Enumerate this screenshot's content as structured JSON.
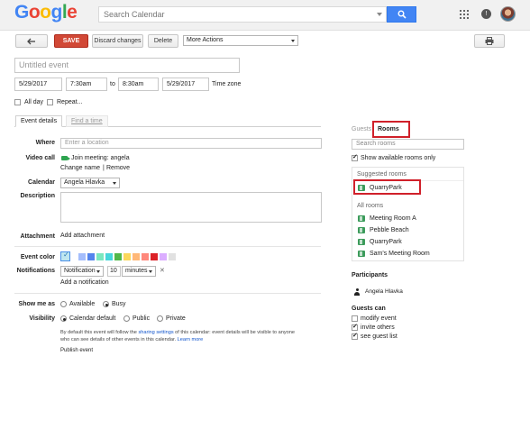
{
  "header": {
    "logo_letters": [
      {
        "ch": "G",
        "color": "#4285f4"
      },
      {
        "ch": "o",
        "color": "#ea4335"
      },
      {
        "ch": "o",
        "color": "#fbbc05"
      },
      {
        "ch": "g",
        "color": "#4285f4"
      },
      {
        "ch": "l",
        "color": "#34a853"
      },
      {
        "ch": "e",
        "color": "#ea4335"
      }
    ],
    "search_placeholder": "Search Calendar"
  },
  "toolbar": {
    "back_icon": "arrow-left-icon",
    "save": "SAVE",
    "discard": "Discard changes",
    "delete": "Delete",
    "more_actions": "More Actions",
    "print_icon": "printer-icon"
  },
  "event": {
    "title_placeholder": "Untitled event",
    "start_date": "5/29/2017",
    "start_time": "7:30am",
    "to": "to",
    "end_time": "8:30am",
    "end_date": "5/29/2017",
    "time_zone": "Time zone",
    "all_day": "All day",
    "repeat": "Repeat..."
  },
  "tabs": {
    "details": "Event details",
    "find_time": "Find a time"
  },
  "form": {
    "where_label": "Where",
    "where_placeholder": "Enter a location",
    "video_label": "Video call",
    "join_meeting": "Join meeting: angela",
    "change_name": "Change name",
    "sep": "|",
    "remove": "Remove",
    "calendar_label": "Calendar",
    "calendar_value": "Angela Hlavka",
    "description_label": "Description",
    "attachment_label": "Attachment",
    "add_attachment": "Add attachment",
    "event_color_label": "Event color",
    "notifications_label": "Notifications",
    "notification_type": "Notification",
    "notification_amount": "10",
    "notification_unit": "minutes",
    "notification_remove": "✕",
    "add_notification": "Add a notification",
    "show_me_as_label": "Show me as",
    "available": "Available",
    "busy": "Busy",
    "visibility_label": "Visibility",
    "calendar_default": "Calendar default",
    "public": "Public",
    "private": "Private",
    "note_line1_pre": "By default this event will follow the ",
    "note_link": "sharing settings",
    "note_line1_post": " of this calendar: event details will be visible to anyone",
    "note_line2_pre": "who can see details of other events in this calendar. ",
    "learn_more": "Learn more",
    "publish_event": "Publish event"
  },
  "colors": [
    "#a4bdfc",
    "#5484ed",
    "#7ae7bf",
    "#46d6db",
    "#51b749",
    "#fbd75b",
    "#ffb878",
    "#ff887c",
    "#dc2127",
    "#dbadff",
    "#e1e1e1"
  ],
  "right_panel": {
    "guests_tab": "Guests",
    "rooms_tab": "Rooms",
    "search_rooms_placeholder": "Search rooms",
    "show_available": "Show available rooms only",
    "suggested_heading": "Suggested rooms",
    "suggested_rooms": [
      "QuarryPark"
    ],
    "all_heading": "All rooms",
    "all_rooms": [
      "Meeting Room A",
      "Pebble Beach",
      "QuarryPark",
      "Sam's Meeting Room"
    ],
    "participants_heading": "Participants",
    "participant": "Angela Hlavka",
    "guests_can_heading": "Guests can",
    "guest_permissions": [
      {
        "label": "modify event",
        "checked": false
      },
      {
        "label": "invite others",
        "checked": true
      },
      {
        "label": "see guest list",
        "checked": true
      }
    ]
  },
  "accent": {
    "save_red": "#d14836",
    "link_blue": "#1155cc",
    "highlight_red": "#d0202a",
    "room_green": "#3c9b5b"
  }
}
